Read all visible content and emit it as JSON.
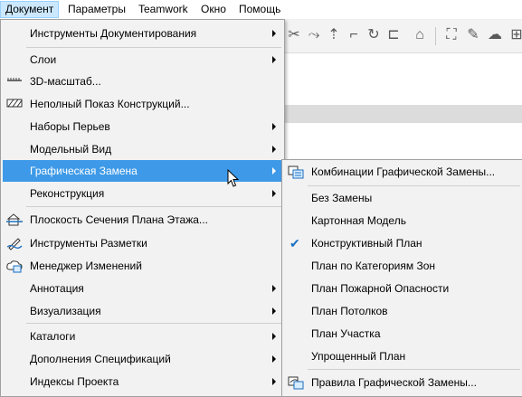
{
  "menubar": {
    "items": [
      "Документ",
      "Параметры",
      "Teamwork",
      "Окно",
      "Помощь"
    ]
  },
  "main_menu": {
    "items": [
      {
        "label": "Инструменты Документирования"
      },
      {
        "label": "Слои"
      },
      {
        "label": "3D-масштаб..."
      },
      {
        "label": "Неполный Показ Конструкций..."
      },
      {
        "label": "Наборы Перьев"
      },
      {
        "label": "Модельный Вид"
      },
      {
        "label": "Графическая Замена"
      },
      {
        "label": "Реконструкция"
      },
      {
        "label": "Плоскость Сечения Плана Этажа..."
      },
      {
        "label": "Инструменты Разметки"
      },
      {
        "label": "Менеджер Изменений"
      },
      {
        "label": "Аннотация"
      },
      {
        "label": "Визуализация"
      },
      {
        "label": "Каталоги"
      },
      {
        "label": "Дополнения Спецификаций"
      },
      {
        "label": "Индексы Проекта"
      }
    ]
  },
  "sub_menu": {
    "items": [
      {
        "label": "Комбинации Графической Замены..."
      },
      {
        "label": "Без Замены"
      },
      {
        "label": "Картонная Модель"
      },
      {
        "label": "Конструктивный План",
        "checked": true
      },
      {
        "label": "План по Категориям Зон"
      },
      {
        "label": "План Пожарной Опасности"
      },
      {
        "label": "План Потолков"
      },
      {
        "label": "План Участка"
      },
      {
        "label": "Упрощенный План"
      },
      {
        "label": "Правила Графической Замены..."
      }
    ]
  },
  "colors": {
    "highlight": "#3e9ae8",
    "menu_bg": "#f2f2f2",
    "menubar_active": "#cce8ff"
  }
}
